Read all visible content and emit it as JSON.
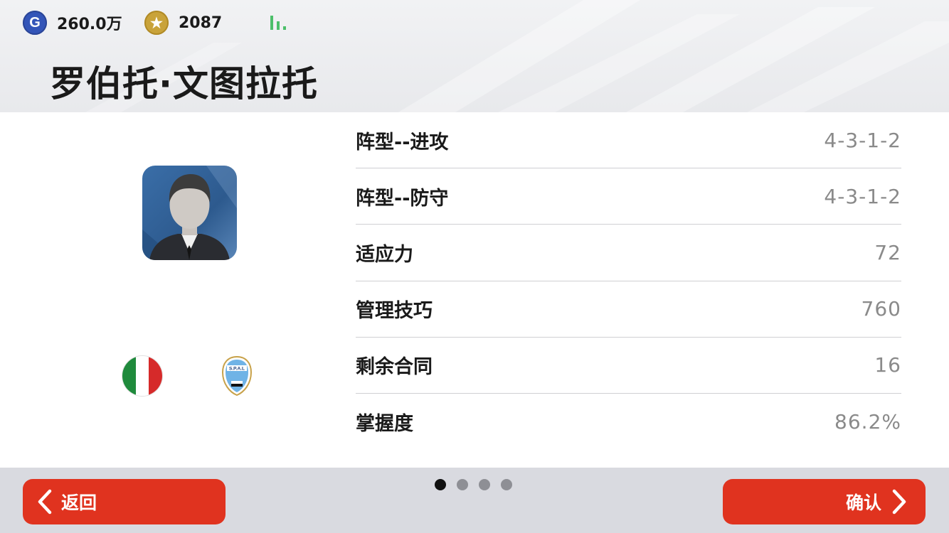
{
  "header": {
    "gp": {
      "icon": "gp-coin-icon",
      "value": "260.0万",
      "color": "#3355b8"
    },
    "coins": {
      "icon": "star-coin-icon",
      "value": "2087",
      "color": "#c9a33a"
    },
    "signal_icon": "signal-bars-icon",
    "player_name": "罗伯托·文图拉托"
  },
  "profile": {
    "avatar_icon": "manager-avatar-icon",
    "flag_icon": "italy-flag-icon",
    "club_icon": "spal-club-badge-icon"
  },
  "stats": [
    {
      "label": "阵型--进攻",
      "value": "4-3-1-2"
    },
    {
      "label": "阵型--防守",
      "value": "4-3-1-2"
    },
    {
      "label": "适应力",
      "value": "72"
    },
    {
      "label": "管理技巧",
      "value": "760"
    },
    {
      "label": "剩余合同",
      "value": "16"
    },
    {
      "label": "掌握度",
      "value": "86.2%"
    }
  ],
  "footer": {
    "back_label": "返回",
    "confirm_label": "确认",
    "page_indicator": {
      "current": 1,
      "total": 4
    },
    "button_color": "#e0331f"
  }
}
